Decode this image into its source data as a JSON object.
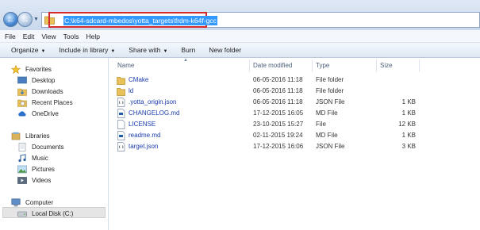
{
  "address": {
    "path": "C:\\k64-sdcard-mbedos\\yotta_targets\\frdm-k64f-gcc",
    "highlight_color": "#d42a2a"
  },
  "menu": [
    "File",
    "Edit",
    "View",
    "Tools",
    "Help"
  ],
  "toolbar": [
    {
      "label": "Organize",
      "dropdown": true
    },
    {
      "label": "Include in library",
      "dropdown": true
    },
    {
      "label": "Share with",
      "dropdown": true
    },
    {
      "label": "Burn",
      "dropdown": false
    },
    {
      "label": "New folder",
      "dropdown": false
    }
  ],
  "nav": {
    "favorites": "Favorites",
    "favorite_items": [
      "Desktop",
      "Downloads",
      "Recent Places",
      "OneDrive"
    ],
    "libraries": "Libraries",
    "library_items": [
      "Documents",
      "Music",
      "Pictures",
      "Videos"
    ],
    "computer": "Computer",
    "computer_items": [
      "Local Disk (C:)"
    ]
  },
  "columns": {
    "name": "Name",
    "date": "Date modified",
    "type": "Type",
    "size": "Size"
  },
  "files": [
    {
      "name": "CMake",
      "date": "06-05-2016 11:18",
      "type": "File folder",
      "size": "",
      "icon": "folder-icon"
    },
    {
      "name": "ld",
      "date": "06-05-2016 11:18",
      "type": "File folder",
      "size": "",
      "icon": "folder-icon"
    },
    {
      "name": ".yotta_origin.json",
      "date": "06-05-2016 11:18",
      "type": "JSON File",
      "size": "1 KB",
      "icon": "json-file-icon"
    },
    {
      "name": "CHANGELOG.md",
      "date": "17-12-2015 16:05",
      "type": "MD File",
      "size": "1 KB",
      "icon": "md-file-icon"
    },
    {
      "name": "LICENSE",
      "date": "23-10-2015 15:27",
      "type": "File",
      "size": "12 KB",
      "icon": "file-icon"
    },
    {
      "name": "readme.md",
      "date": "02-11-2015 19:24",
      "type": "MD File",
      "size": "1 KB",
      "icon": "md-file-icon"
    },
    {
      "name": "target.json",
      "date": "17-12-2015 16:06",
      "type": "JSON File",
      "size": "3 KB",
      "icon": "json-file-icon"
    }
  ]
}
